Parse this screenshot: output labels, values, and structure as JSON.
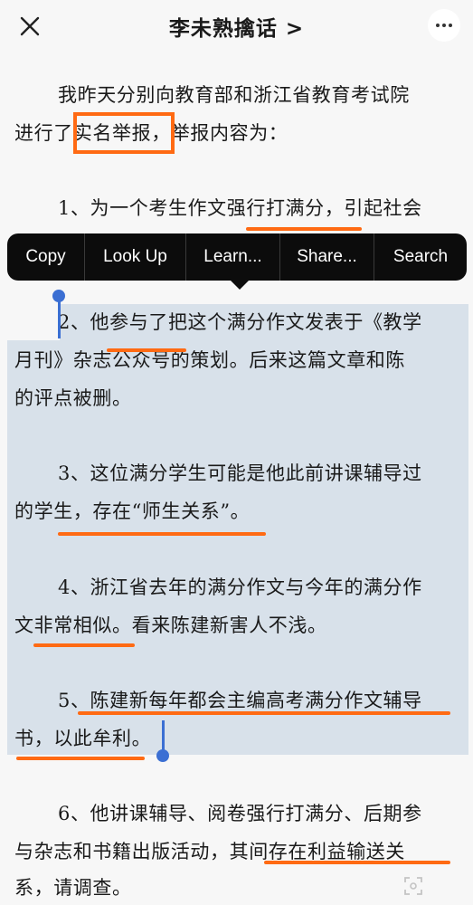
{
  "header": {
    "title": "李未熟擒话 >"
  },
  "article": {
    "lines": {
      "p0_l1": "我昨天分别向教育部和浙江省教育考试院",
      "p0_l2": "进行了实名举报，举报内容为：",
      "p1_l1": "1、为一个考生作文强行打满分，引起社会",
      "p2_l1": "2、他参与了把这个满分作文发表于《教学",
      "p2_l2": "月刊》杂志公众号的策划。后来这篇文章和陈",
      "p2_l3": "的评点被删。",
      "p3_l1": "3、这位满分学生可能是他此前讲课辅导过",
      "p3_l2": "的学生，存在“师生关系”。",
      "p4_l1": "4、浙江省去年的满分作文与今年的满分作",
      "p4_l2": "文非常相似。看来陈建新害人不浅。",
      "p5_l1": "5、陈建新每年都会主编高考满分作文辅导",
      "p5_l2": "书，以此牟利。",
      "p6_l1": "6、他讲课辅导、阅卷强行打满分、后期参",
      "p6_l2": "与杂志和书籍出版活动，其间存在利益输送关",
      "p6_l3": "系，请调查。"
    }
  },
  "context_menu": {
    "copy": "Copy",
    "look_up": "Look Up",
    "learn": "Learn...",
    "share": "Share...",
    "search": "Search"
  },
  "colors": {
    "annotation": "#ff6a13",
    "selection": "#d8e1ea",
    "handle": "#3b6fd3"
  }
}
